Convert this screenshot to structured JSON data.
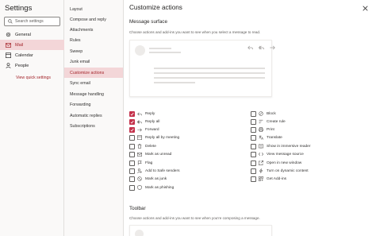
{
  "settings": {
    "title": "Settings",
    "search_placeholder": "Search settings",
    "categories": [
      {
        "label": "General",
        "icon": "gear-icon"
      },
      {
        "label": "Mail",
        "icon": "mail-icon",
        "active": true
      },
      {
        "label": "Calendar",
        "icon": "calendar-icon"
      },
      {
        "label": "People",
        "icon": "people-icon"
      }
    ],
    "quick_link": "View quick settings"
  },
  "mail_nav": {
    "items": [
      {
        "label": "Layout"
      },
      {
        "label": "Compose and reply"
      },
      {
        "label": "Attachments"
      },
      {
        "label": "Rules"
      },
      {
        "label": "Sweep"
      },
      {
        "label": "Junk email"
      },
      {
        "label": "Customize actions",
        "active": true
      },
      {
        "label": "Sync email"
      },
      {
        "label": "Message handling"
      },
      {
        "label": "Forwarding"
      },
      {
        "label": "Automatic replies"
      },
      {
        "label": "Subscriptions"
      }
    ]
  },
  "main": {
    "title": "Customize actions",
    "message_surface": {
      "heading": "Message surface",
      "description": "Choose actions and add-ins you want to see when you select a message to read."
    },
    "actions_left": [
      {
        "label": "Reply",
        "checked": true,
        "icon": "reply-icon"
      },
      {
        "label": "Reply all",
        "checked": true,
        "icon": "reply-all-icon"
      },
      {
        "label": "Forward",
        "checked": true,
        "icon": "forward-icon"
      },
      {
        "label": "Reply all by meeting",
        "checked": false,
        "icon": "calendar-reply-icon"
      },
      {
        "label": "Delete",
        "checked": false,
        "icon": "trash-icon"
      },
      {
        "label": "Mark as unread",
        "checked": false,
        "icon": "envelope-icon"
      },
      {
        "label": "Flag",
        "checked": false,
        "icon": "flag-icon"
      },
      {
        "label": "Add to Safe senders",
        "checked": false,
        "icon": "person-add-icon"
      },
      {
        "label": "Mark as junk",
        "checked": false,
        "icon": "junk-icon"
      },
      {
        "label": "Mark as phishing",
        "checked": false,
        "icon": "phishing-icon"
      }
    ],
    "actions_right": [
      {
        "label": "Block",
        "checked": false,
        "icon": "block-icon"
      },
      {
        "label": "Create rule",
        "checked": false,
        "icon": "rule-icon"
      },
      {
        "label": "Print",
        "checked": false,
        "icon": "print-icon"
      },
      {
        "label": "Translate",
        "checked": false,
        "icon": "translate-icon"
      },
      {
        "label": "Show in immersive reader",
        "checked": false,
        "icon": "immersive-reader-icon"
      },
      {
        "label": "View message source",
        "checked": false,
        "icon": "source-icon"
      },
      {
        "label": "Open in new window",
        "checked": false,
        "icon": "new-window-icon"
      },
      {
        "label": "Turn on dynamic content",
        "checked": false,
        "icon": "dynamic-content-icon"
      },
      {
        "label": "Get Add-ins",
        "checked": false,
        "icon": "add-ins-icon"
      }
    ],
    "toolbar": {
      "heading": "Toolbar",
      "description": "Choose actions and add-ins you want to see when you're composing a message."
    }
  },
  "colors": {
    "accent": "#c4314b",
    "active_bg": "#f3d6d8",
    "link": "#a4262c"
  }
}
